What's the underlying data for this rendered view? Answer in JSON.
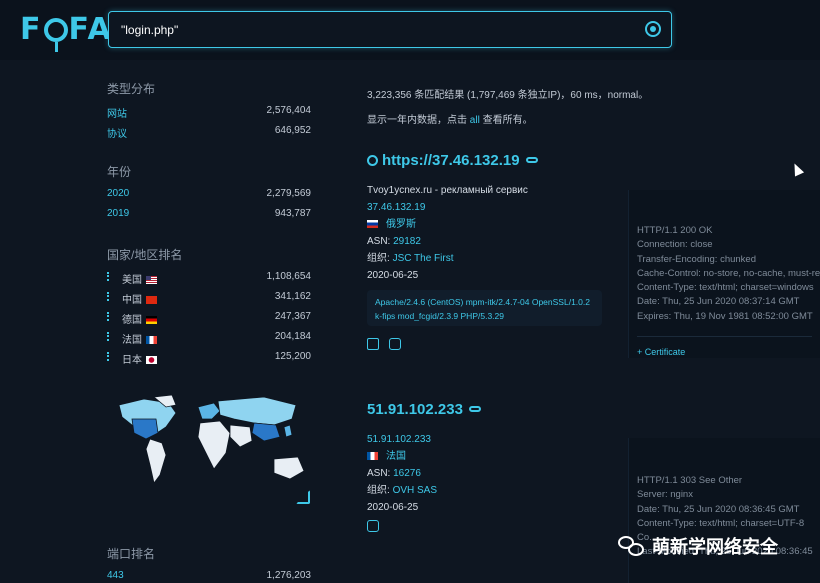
{
  "header": {
    "logo": "FOFA",
    "search_value": "\"login.php\""
  },
  "sidebar": {
    "type_title": "类型分布",
    "types": [
      {
        "label": "网站",
        "count": "2,576,404"
      },
      {
        "label": "协议",
        "count": "646,952"
      }
    ],
    "year_title": "年份",
    "years": [
      {
        "label": "2020",
        "count": "2,279,569"
      },
      {
        "label": "2019",
        "count": "943,787"
      }
    ],
    "country_title": "国家/地区排名",
    "countries": [
      {
        "label": "美国",
        "count": "1,108,654",
        "flag": "us"
      },
      {
        "label": "中国",
        "count": "341,162",
        "flag": "cn"
      },
      {
        "label": "德国",
        "count": "247,367",
        "flag": "de"
      },
      {
        "label": "法国",
        "count": "204,184",
        "flag": "fr"
      },
      {
        "label": "日本",
        "count": "125,200",
        "flag": "jp"
      }
    ],
    "port_title": "端口排名",
    "ports": [
      {
        "label": "443",
        "count": "1,276,203"
      }
    ]
  },
  "summary": {
    "line1": "3,223,356 条匹配结果 (1,797,469 条独立IP)，60 ms，normal。",
    "line2_prefix": "显示一年内数据，点击 ",
    "line2_link": "all",
    "line2_suffix": " 查看所有。"
  },
  "results": [
    {
      "title": "https://37.46.132.19",
      "site_title": "Tvoy1ycnex.ru - рекламный сервис",
      "ip": "37.46.132.19",
      "country": "俄罗斯",
      "asn_label": "ASN:",
      "asn": "29182",
      "org_label": "组织:",
      "org": "JSC The First",
      "date": "2020-06-25",
      "banner": "Apache/2.4.6 (CentOS) mpm-itk/2.4.7-04 OpenSSL/1.0.2 k-fips mod_fcgid/2.3.9 PHP/5.3.29",
      "headers": [
        "HTTP/1.1 200 OK",
        "Connection: close",
        "Transfer-Encoding: chunked",
        "Cache-Control: no-store, no-cache, must-re",
        "Content-Type: text/html; charset=windows",
        "Date: Thu, 25 Jun 2020 08:37:14 GMT",
        "Expires: Thu, 19 Nov 1981 08:52:00 GMT"
      ],
      "cert_label": "+ Certificate"
    },
    {
      "title": "51.91.102.233",
      "ip": "51.91.102.233",
      "country": "法国",
      "asn_label": "ASN:",
      "asn": "16276",
      "org_label": "组织:",
      "org": "OVH SAS",
      "date": "2020-06-25",
      "headers": [
        "HTTP/1.1 303 See Other",
        "Server: nginx",
        "Date: Thu, 25 Jun 2020 08:36:45 GMT",
        "Content-Type: text/html; charset=UTF-8",
        "Co...",
        "Last-Modified: Thu, 25 Jun 2020 08:36:45"
      ]
    }
  ],
  "watermark": "萌新学网络安全"
}
